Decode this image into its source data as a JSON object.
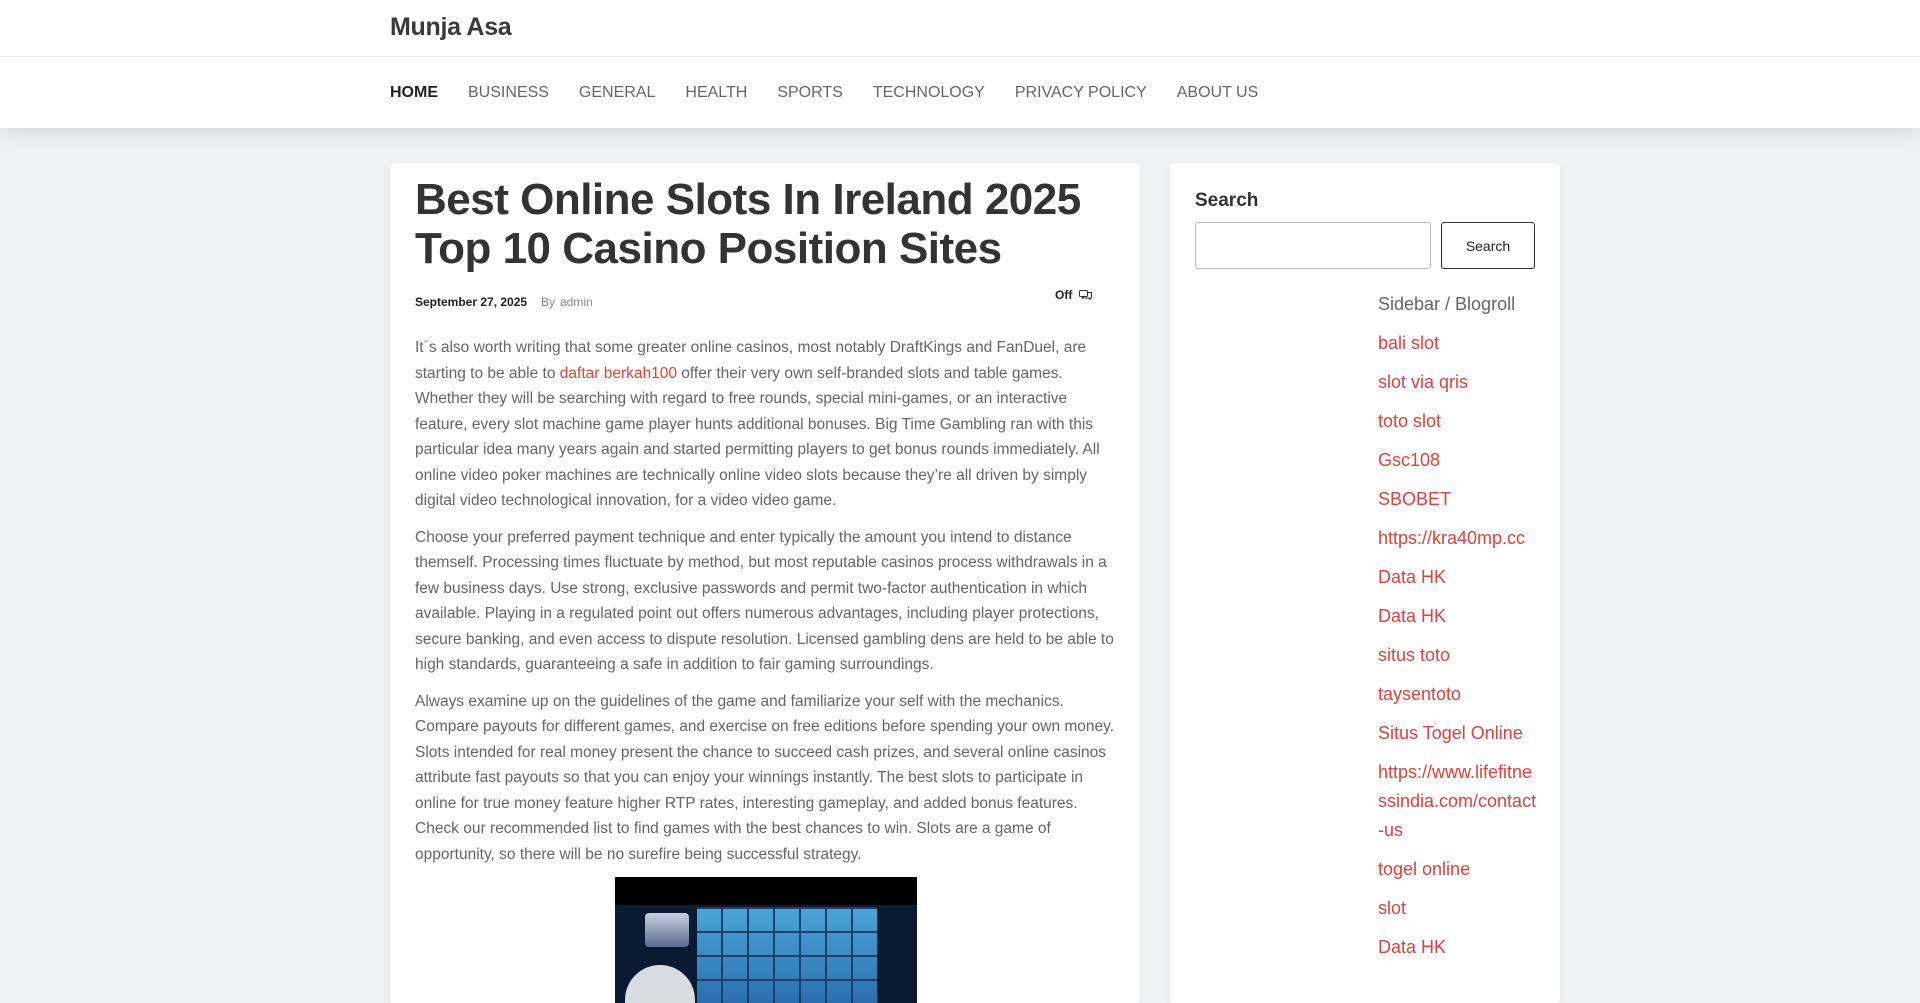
{
  "site": {
    "title": "Munja Asa"
  },
  "nav": {
    "items": [
      {
        "label": "HOME",
        "active": true
      },
      {
        "label": "BUSINESS"
      },
      {
        "label": "GENERAL"
      },
      {
        "label": "HEALTH"
      },
      {
        "label": "SPORTS"
      },
      {
        "label": "TECHNOLOGY"
      },
      {
        "label": "PRIVACY POLICY"
      },
      {
        "label": "ABOUT US"
      }
    ]
  },
  "article": {
    "title": "Best Online Slots In Ireland 2025 Top 10 Casino Position Sites",
    "date": "September 27, 2025",
    "by_label": "By",
    "author": "admin",
    "comments": "Off",
    "p1_before": "It´s also worth writing that some greater online casinos, most notably DraftKings and FanDuel, are starting to be able to ",
    "p1_link": "daftar berkah100",
    "p1_after": " offer their very own self-branded slots and table games. Whether they will be searching with regard to free rounds, special mini-games, or an interactive feature, every slot machine game player hunts additional bonuses. Big Time Gambling ran with this particular idea many years again and started permitting players to get bonus rounds immediately. All online video poker machines are technically online video slots because they’re all driven by simply digital video technological innovation, for a video video game.",
    "p2": "Choose your preferred payment technique and enter typically the amount you intend to distance themself. Processing times fluctuate by method, but most reputable casinos process withdrawals in a few business days. Use strong, exclusive passwords and permit two-factor authentication in which available. Playing in a regulated point out offers numerous advantages, including player protections, secure banking, and even access to dispute resolution. Licensed gambling dens are held to be able to high standards, guaranteeing a safe in addition to fair gaming surroundings.",
    "p3": "Always examine up on the guidelines of the game and familiarize your self with the mechanics. Compare payouts for different games, and exercise on free editions before spending your own money. Slots intended for real money present the chance to succeed cash prizes, and several online casinos attribute fast payouts so that you can enjoy your winnings instantly. The best slots to participate in online for true money feature higher RTP rates, interesting gameplay, and added bonus features. Check our recommended list to find games with the best chances to win. Slots are a game of opportunity, so there will be no surefire being successful strategy."
  },
  "sidebar": {
    "search_label": "Search",
    "search_value": "",
    "search_button": "Search",
    "blogroll_title": "Sidebar / Blogroll",
    "links": [
      "bali slot",
      "slot via qris",
      "toto slot",
      "Gsc108",
      "SBOBET",
      "https://kra40mp.cc",
      "Data HK",
      "Data HK",
      "situs toto",
      "taysentoto",
      "Situs Togel Online",
      "https://www.lifefitnessindia.com/contact-us",
      "togel online",
      "slot",
      "Data HK"
    ]
  },
  "colors": {
    "link": "#d9443d",
    "text": "#666666",
    "heading": "#333333",
    "background": "#f1f2f4"
  }
}
